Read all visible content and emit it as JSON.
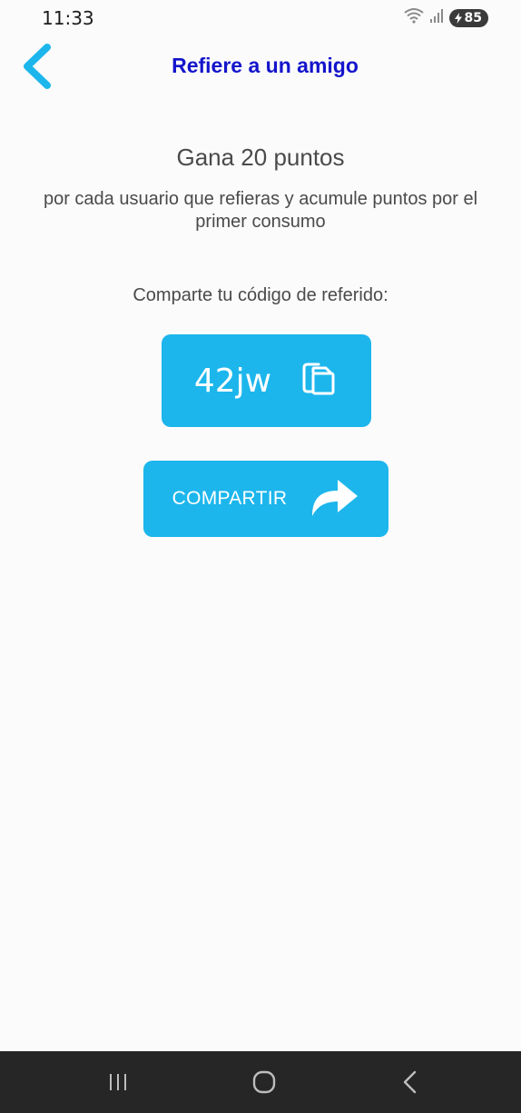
{
  "status_bar": {
    "time": "11:33",
    "battery_level": "85"
  },
  "header": {
    "title": "Refiere a un amigo"
  },
  "main": {
    "headline": "Gana 20 puntos",
    "description": "por cada usuario que refieras y acumule puntos por el primer consumo",
    "share_prompt": "Comparte tu código de referido:",
    "referral_code": "42jw",
    "share_button_label": "COMPARTIR"
  },
  "colors": {
    "accent": "#1cb6ec",
    "title": "#1414cc",
    "text": "#4a4a4a",
    "nav_bar": "#262626"
  },
  "icons": {
    "back": "chevron-left-icon",
    "copy": "copy-icon",
    "share": "share-arrow-icon",
    "wifi": "wifi-icon",
    "signal": "signal-icon",
    "battery": "battery-icon",
    "nav_recents": "recents-icon",
    "nav_home": "home-icon",
    "nav_back": "back-icon"
  }
}
